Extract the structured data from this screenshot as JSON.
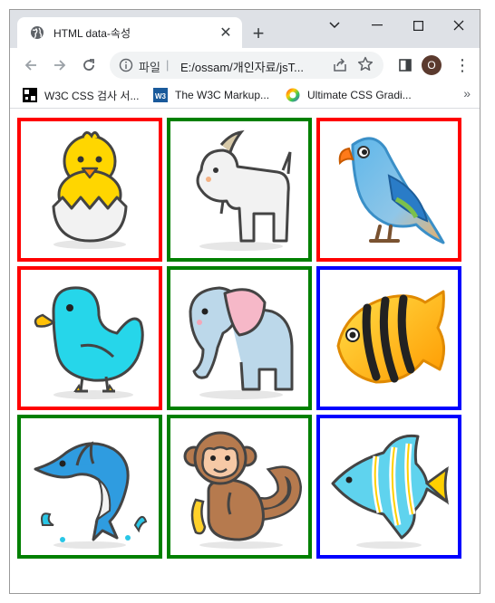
{
  "browser": {
    "tab_title": "HTML data-속성",
    "tab_close": "✕",
    "new_tab": "+",
    "window_controls": {
      "minimize": "—",
      "maximize": "☐",
      "close": "✕",
      "dropdown": "⌄"
    },
    "address": {
      "scheme_label": "파일",
      "separator": "|",
      "url": "E:/ossam/개인자료/jsT..."
    },
    "profile_initial": "O",
    "menu": "⋮"
  },
  "bookmarks": [
    {
      "label": "W3C CSS 검사 서...",
      "icon": "w3c-validator-icon"
    },
    {
      "label": "The W3C Markup...",
      "icon": "w3c-icon"
    },
    {
      "label": "Ultimate CSS Gradi...",
      "icon": "gradient-icon"
    }
  ],
  "bookmarks_more": "»",
  "grid": {
    "border_colors": {
      "red": "#ff0000",
      "green": "#008000",
      "blue": "#0000ff"
    },
    "cells": [
      {
        "animal": "chick",
        "border": "red"
      },
      {
        "animal": "goat",
        "border": "green"
      },
      {
        "animal": "parrot",
        "border": "red"
      },
      {
        "animal": "bird",
        "border": "red"
      },
      {
        "animal": "elephant",
        "border": "green"
      },
      {
        "animal": "tropical-fish",
        "border": "blue"
      },
      {
        "animal": "dolphin",
        "border": "green"
      },
      {
        "animal": "monkey",
        "border": "green"
      },
      {
        "animal": "angelfish",
        "border": "blue"
      }
    ]
  }
}
